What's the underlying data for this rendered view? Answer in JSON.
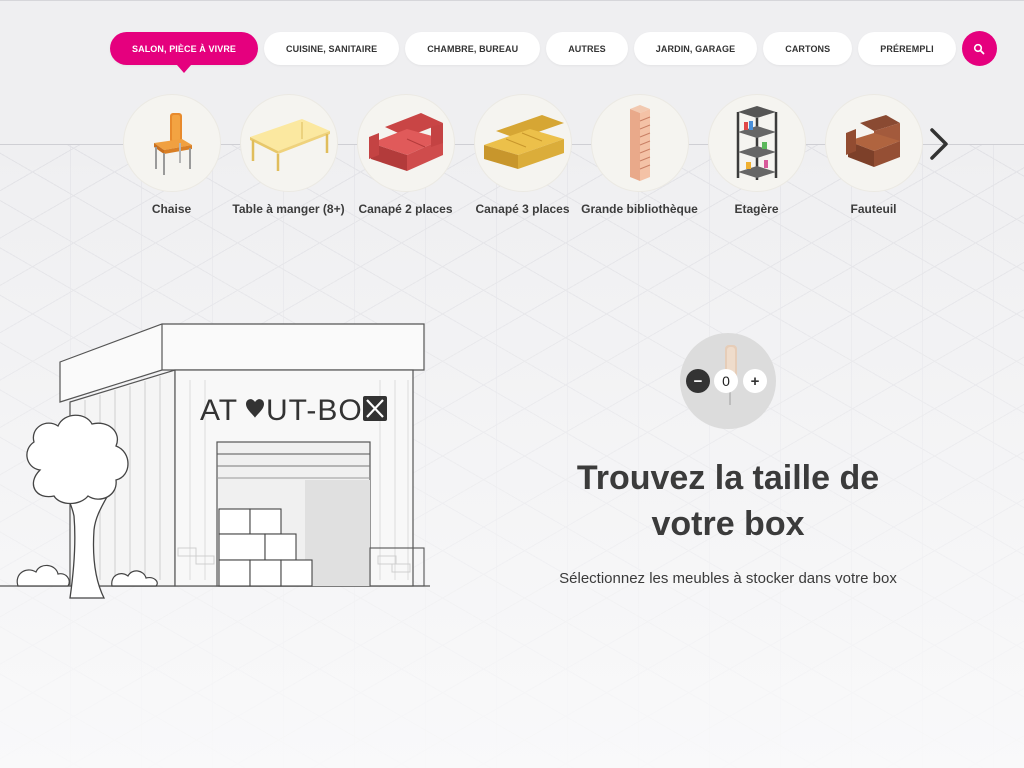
{
  "categories": [
    {
      "label": "SALON, PIÈCE À VIVRE",
      "active": true
    },
    {
      "label": "CUISINE, SANITAIRE"
    },
    {
      "label": "CHAMBRE, BUREAU"
    },
    {
      "label": "AUTRES"
    },
    {
      "label": "JARDIN, GARAGE"
    },
    {
      "label": "CARTONS"
    },
    {
      "label": "PRÉREMPLI"
    }
  ],
  "search": {
    "icon": "search-icon"
  },
  "furniture": [
    {
      "label": "Chaise",
      "icon": "chair-icon"
    },
    {
      "label": "Table à manger (8+)",
      "icon": "dining-table-icon"
    },
    {
      "label": "Canapé 2 places",
      "icon": "sofa-2-icon"
    },
    {
      "label": "Canapé 3 places",
      "icon": "sofa-3-icon"
    },
    {
      "label": "Grande bibliothèque",
      "icon": "bookcase-icon"
    },
    {
      "label": "Etagère",
      "icon": "shelf-icon"
    },
    {
      "label": "Fauteuil",
      "icon": "armchair-icon"
    }
  ],
  "hero": {
    "brand": "AT♥UT-BOX",
    "quantity": "0",
    "minus": "−",
    "plus": "+",
    "headline_line1": "Trouvez la taille de",
    "headline_line2": "votre box",
    "subline": "Sélectionnez les meubles à stocker dans votre box"
  },
  "colors": {
    "accent": "#e5007e",
    "text": "#3b3b3b",
    "background": "#efeff1"
  }
}
